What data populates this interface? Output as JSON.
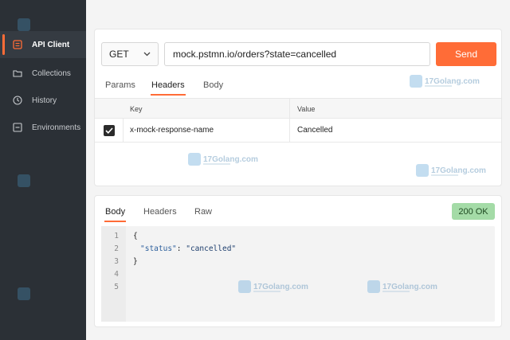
{
  "sidebar": {
    "items": [
      {
        "label": "API Client",
        "icon": "grid-icon",
        "active": true
      },
      {
        "label": "Collections",
        "icon": "folder-icon",
        "active": false
      },
      {
        "label": "History",
        "icon": "clock-icon",
        "active": false
      },
      {
        "label": "Environments",
        "icon": "environments-icon",
        "active": false
      }
    ]
  },
  "request": {
    "method": "GET",
    "url": "mock.pstmn.io/orders?state=cancelled",
    "send_label": "Send",
    "tabs": [
      {
        "label": "Params",
        "active": false
      },
      {
        "label": "Headers",
        "active": true
      },
      {
        "label": "Body",
        "active": false
      }
    ],
    "headers_table": {
      "columns": [
        "Key",
        "Value"
      ],
      "rows": [
        {
          "checked": true,
          "key": "x-mock-response-name",
          "value": "Cancelled"
        }
      ]
    }
  },
  "response": {
    "tabs": [
      {
        "label": "Body",
        "active": true
      },
      {
        "label": "Headers",
        "active": false
      },
      {
        "label": "Raw",
        "active": false
      }
    ],
    "status": "200 OK",
    "line_numbers": [
      "1",
      "2",
      "3",
      "4",
      "5"
    ],
    "body": {
      "open": "{",
      "key": "\"status\"",
      "sep": ": ",
      "value": "\"cancelled\"",
      "close": "}"
    }
  },
  "watermark": {
    "text": "17Golang.com"
  },
  "colors": {
    "accent": "#ff6c37",
    "sidebar_bg": "#2b3036",
    "status_badge_bg": "#a4dba7",
    "json_key": "#2d5f9c"
  }
}
